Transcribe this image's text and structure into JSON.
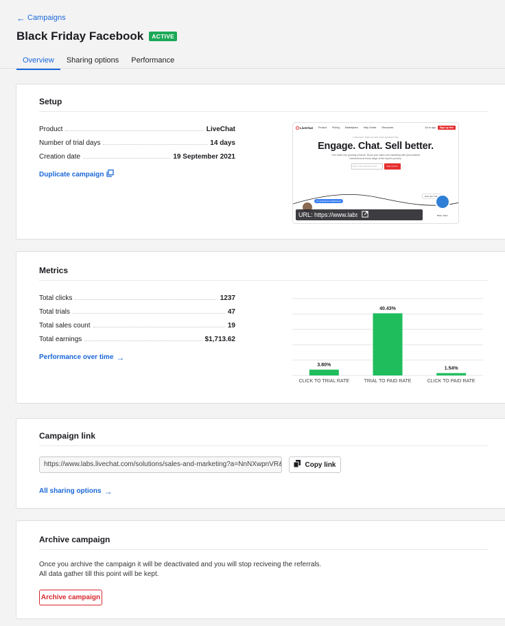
{
  "header": {
    "back_label": "Campaigns",
    "title": "Black Friday Facebook",
    "status_badge": "ACTIVE"
  },
  "tabs": [
    {
      "label": "Overview",
      "active": true
    },
    {
      "label": "Sharing options",
      "active": false
    },
    {
      "label": "Performance",
      "active": false
    }
  ],
  "setup": {
    "title": "Setup",
    "rows": [
      {
        "key": "Product",
        "value": "LiveChat"
      },
      {
        "key": "Number of trial days",
        "value": "14 days"
      },
      {
        "key": "Creation date",
        "value": "19 September 2021"
      }
    ],
    "duplicate_label": "Duplicate campaign",
    "preview": {
      "logo": "LiveChat",
      "nav_items": [
        "Product",
        "Pricing",
        "Marketplace",
        "Help Center",
        "Resources"
      ],
      "nav_sign_in": "Go to app",
      "nav_signup": "Sign up free",
      "subheading": "LIVECHAT FOR SALES AND MARKETING",
      "headline": "Engage. Chat. Sell better.",
      "text": "Turn traffic into growing revenue. Boost your sales and marketing with personalized interactions at every stage of the buyer's journey.",
      "email_placeholder": "Enter your business email",
      "signup_button": "Sign up free",
      "bubble1": "I'm looking for headphones",
      "bubble2": "How can I help?",
      "agent_name": "Bella, Sales",
      "url_tooltip": "URL: https://www.labs.livechat.com/soluti..."
    }
  },
  "metrics": {
    "title": "Metrics",
    "rows": [
      {
        "key": "Total clicks",
        "value": "1237"
      },
      {
        "key": "Total trials",
        "value": "47"
      },
      {
        "key": "Total sales count",
        "value": "19"
      },
      {
        "key": "Total earnings",
        "value": "$1,713.62"
      }
    ],
    "performance_link": "Performance over time"
  },
  "chart_data": {
    "type": "bar",
    "categories": [
      "CLICK TO TRIAL RATE",
      "TRIAL TO PAID RATE",
      "CLICK TO PAID RATE"
    ],
    "values": [
      3.8,
      40.43,
      1.54
    ],
    "value_labels": [
      "3.80%",
      "40.43%",
      "1.54%"
    ],
    "ylim": [
      0,
      50
    ],
    "grid": true,
    "color": "#1fbd5c"
  },
  "campaign_link": {
    "title": "Campaign link",
    "url": "https://www.labs.livechat.com/solutions/sales-and-marketing?a=NnNXwpnVR&utm_c...",
    "copy_label": "Copy link",
    "all_sharing_label": "All sharing options"
  },
  "archive": {
    "title": "Archive campaign",
    "description": "Once you archive the campaign it will be deactivated and you will stop reciveing the referrals. All data gather till this point will be kept.",
    "button_label": "Archive campaign"
  },
  "colors": {
    "accent": "#1a67d8",
    "active_badge": "#1aa857",
    "danger": "#d6262e"
  }
}
